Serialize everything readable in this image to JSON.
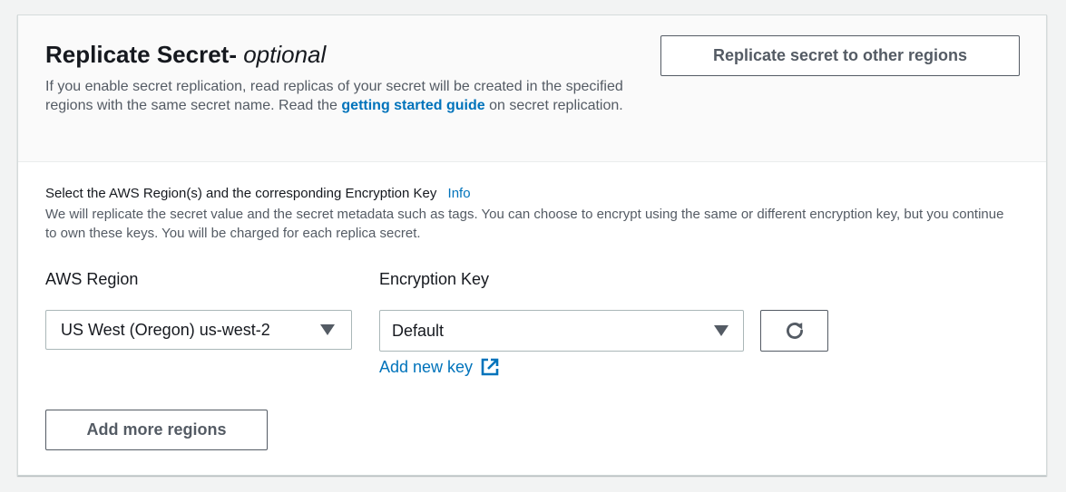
{
  "header": {
    "title": "Replicate Secret-",
    "title_optional": "optional",
    "description_before_link": "If you enable secret replication, read replicas of your secret will be created in the specified regions with the same secret name. Read the ",
    "link_text": "getting started guide",
    "description_after_link": " on secret replication.",
    "replicate_button_label": "Replicate secret to other regions"
  },
  "section": {
    "label": "Select the AWS Region(s) and the corresponding Encryption Key",
    "info_link": "Info",
    "description": "We will replicate the secret value and the secret metadata such as tags. You can choose to encrypt using the same or different encryption key, but you continue to own these keys. You will be charged for each replica secret."
  },
  "region": {
    "label": "AWS Region",
    "selected": "US West (Oregon) us-west-2"
  },
  "encryption": {
    "label": "Encryption Key",
    "selected": "Default",
    "add_key_link": "Add new key"
  },
  "add_more_label": "Add more regions",
  "icons": {
    "refresh": "refresh-icon",
    "external_link": "external-link-icon",
    "dropdown": "caret-down-icon"
  },
  "colors": {
    "link": "#0073bb",
    "button_border": "#545b64",
    "header_bg": "#fafafa",
    "page_bg": "#f2f3f3"
  }
}
